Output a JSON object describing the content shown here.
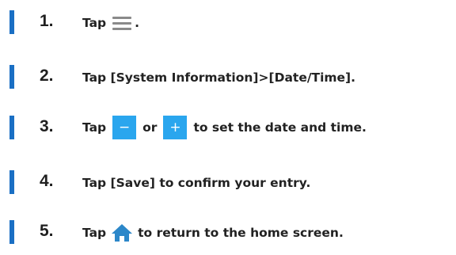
{
  "steps": [
    {
      "number": "1.",
      "before": "Tap",
      "icon": "hamburger-menu-icon",
      "after": "."
    },
    {
      "number": "2.",
      "text": "Tap [System Information]>[Date/Time]."
    },
    {
      "number": "3.",
      "before": "Tap",
      "minus": "−",
      "middle": "or",
      "plus": "+",
      "after": "to set the date and time."
    },
    {
      "number": "4.",
      "text": "Tap [Save] to confirm your entry."
    },
    {
      "number": "5.",
      "before": "Tap",
      "icon": "home-icon",
      "after": "to return to the home screen."
    }
  ],
  "colors": {
    "marker": "#1a6fc4",
    "button": "#2aa6ee",
    "icon_gray": "#8a8a8a",
    "home_icon": "#2c87c9"
  }
}
